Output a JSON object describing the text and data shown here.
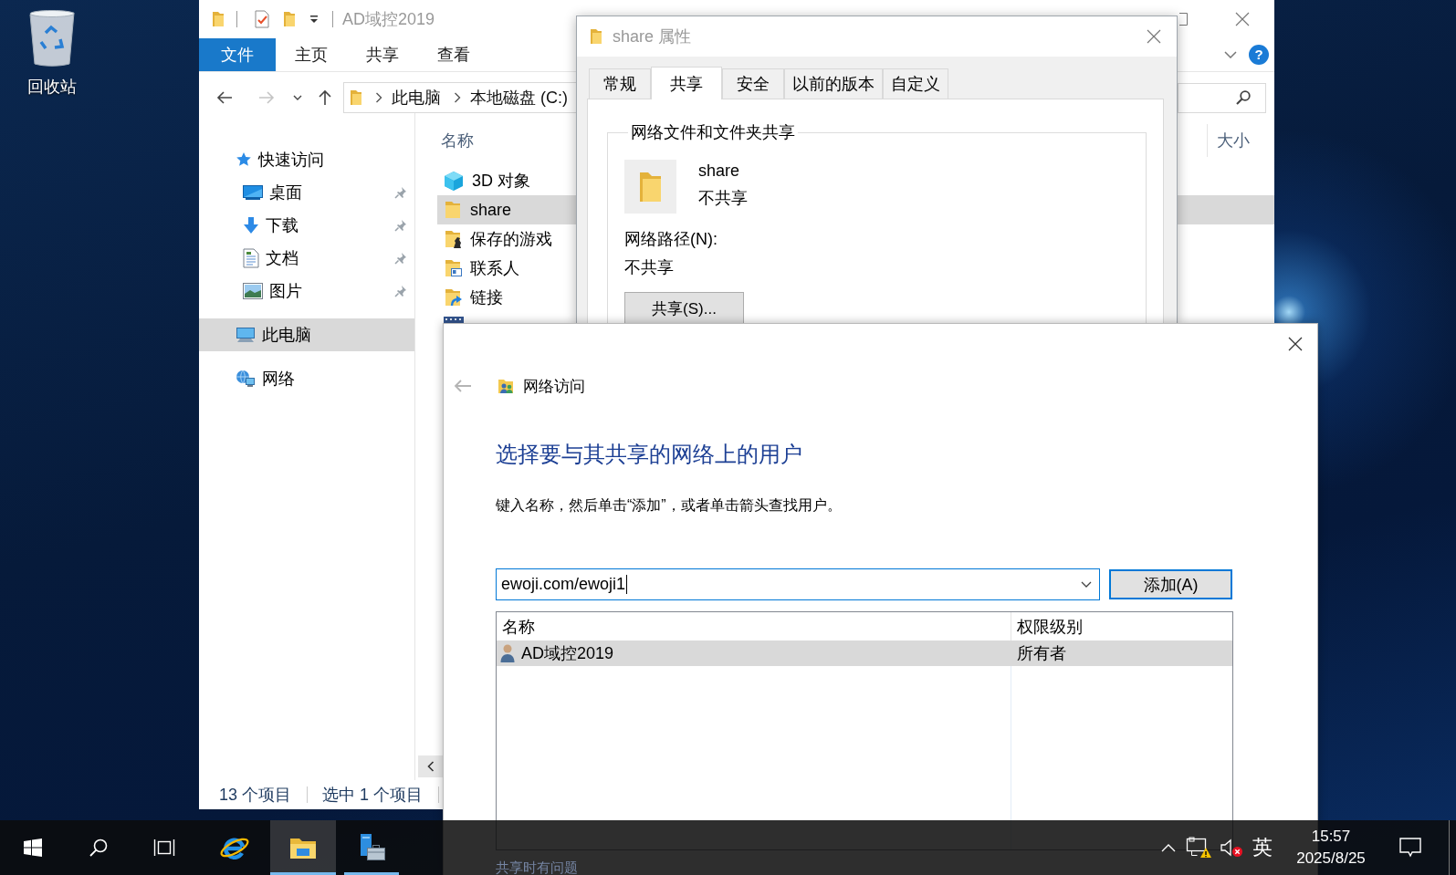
{
  "desktop": {
    "icons": [
      {
        "label": "回收站",
        "kind": "recycle_bin"
      }
    ]
  },
  "explorer": {
    "title": "AD域控2019",
    "ribbon_tabs": [
      {
        "label": "文件",
        "selected": true
      },
      {
        "label": "主页",
        "selected": false
      },
      {
        "label": "共享",
        "selected": false
      },
      {
        "label": "查看",
        "selected": false
      }
    ],
    "help_button": "?",
    "nav_buttons": [
      {
        "kind": "back",
        "disabled": false
      },
      {
        "kind": "forward",
        "disabled": true
      },
      {
        "kind": "recent",
        "disabled": false
      },
      {
        "kind": "up",
        "disabled": false
      }
    ],
    "breadcrumb": [
      "此电脑",
      "本地磁盘 (C:)"
    ],
    "nav_pane": [
      {
        "label": "快速访问",
        "kind": "star",
        "selected": false,
        "children": [
          {
            "label": "桌面",
            "kind": "desktop",
            "selected": false,
            "pinned": true
          },
          {
            "label": "下载",
            "kind": "download",
            "selected": false,
            "pinned": true
          },
          {
            "label": "文档",
            "kind": "documents",
            "selected": false,
            "pinned": true
          },
          {
            "label": "图片",
            "kind": "pictures",
            "selected": false,
            "pinned": true
          }
        ]
      },
      {
        "label": "此电脑",
        "kind": "pc",
        "selected": true
      },
      {
        "label": "网络",
        "kind": "network",
        "selected": false
      }
    ],
    "columns": [
      "名称",
      "大小"
    ],
    "files": [
      {
        "name": "3D 对象",
        "kind": "cube",
        "selected": false
      },
      {
        "name": "share",
        "kind": "folder",
        "selected": true
      },
      {
        "name": "保存的游戏",
        "kind": "games",
        "selected": false
      },
      {
        "name": "联系人",
        "kind": "contacts",
        "selected": false
      },
      {
        "name": "链接",
        "kind": "links",
        "selected": false
      },
      {
        "kind": "videos",
        "selected": false
      }
    ],
    "status_bar": {
      "item_count": "13 个项目",
      "selection": "选中 1 个项目"
    }
  },
  "properties_dialog": {
    "title": "share 属性",
    "tabs": [
      {
        "label": "常规",
        "selected": false
      },
      {
        "label": "共享",
        "selected": true
      },
      {
        "label": "安全",
        "selected": false
      },
      {
        "label": "以前的版本",
        "selected": false
      },
      {
        "label": "自定义",
        "selected": false
      }
    ],
    "group_label": "网络文件和文件夹共享",
    "folder_name": "share",
    "share_status": "不共享",
    "network_path_label": "网络路径(N):",
    "network_path": "不共享",
    "share_button": "共享(S)..."
  },
  "network_access_dialog": {
    "title": "网络访问",
    "back_disabled": true,
    "heading": "选择要与其共享的网络上的用户",
    "instruction": "键入名称，然后单击“添加”，或者单击箭头查找用户。",
    "user_field": {
      "value": "ewoji.com/ewoji1"
    },
    "add_button": "添加(A)",
    "table": {
      "columns": [
        "名称",
        "权限级别"
      ],
      "rows": [
        {
          "name": "AD域控2019",
          "permission": "所有者",
          "selected": true
        }
      ]
    },
    "help_link": "共享时有问题"
  },
  "taskbar": {
    "apps": [
      {
        "kind": "ie",
        "running": false,
        "active": false
      },
      {
        "kind": "explorer",
        "running": true,
        "active": true
      },
      {
        "kind": "server_manager",
        "running": true,
        "active": false
      }
    ],
    "tray_icons": [
      {
        "kind": "network",
        "alert": true
      },
      {
        "kind": "volume",
        "alert": true
      }
    ],
    "input_method": "英",
    "time": "15:57",
    "date": "2025/8/25"
  }
}
